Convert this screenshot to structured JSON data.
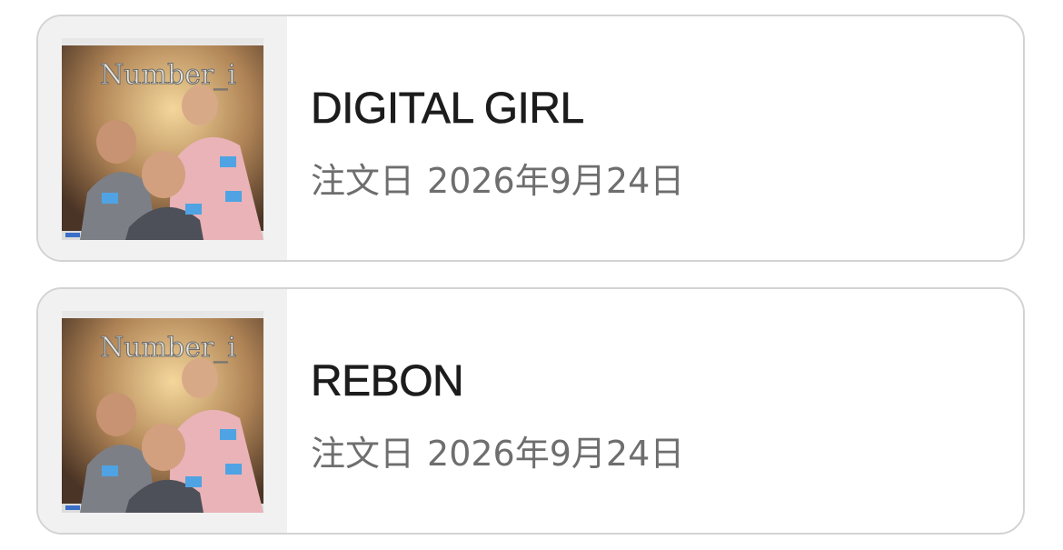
{
  "orders": [
    {
      "title": "DIGITAL GIRL",
      "date_label": "注文日",
      "date_value": "2026年9月24日",
      "cover_text": "Number_i"
    },
    {
      "title": "REBON",
      "date_label": "注文日",
      "date_value": "2026年9月24日",
      "cover_text": "Number_i"
    }
  ],
  "colors": {
    "card_border": "#d3d3d3",
    "thumb_background": "#f1f1f1",
    "title_text": "#1c1c1c",
    "date_text": "#6e6e6e"
  }
}
